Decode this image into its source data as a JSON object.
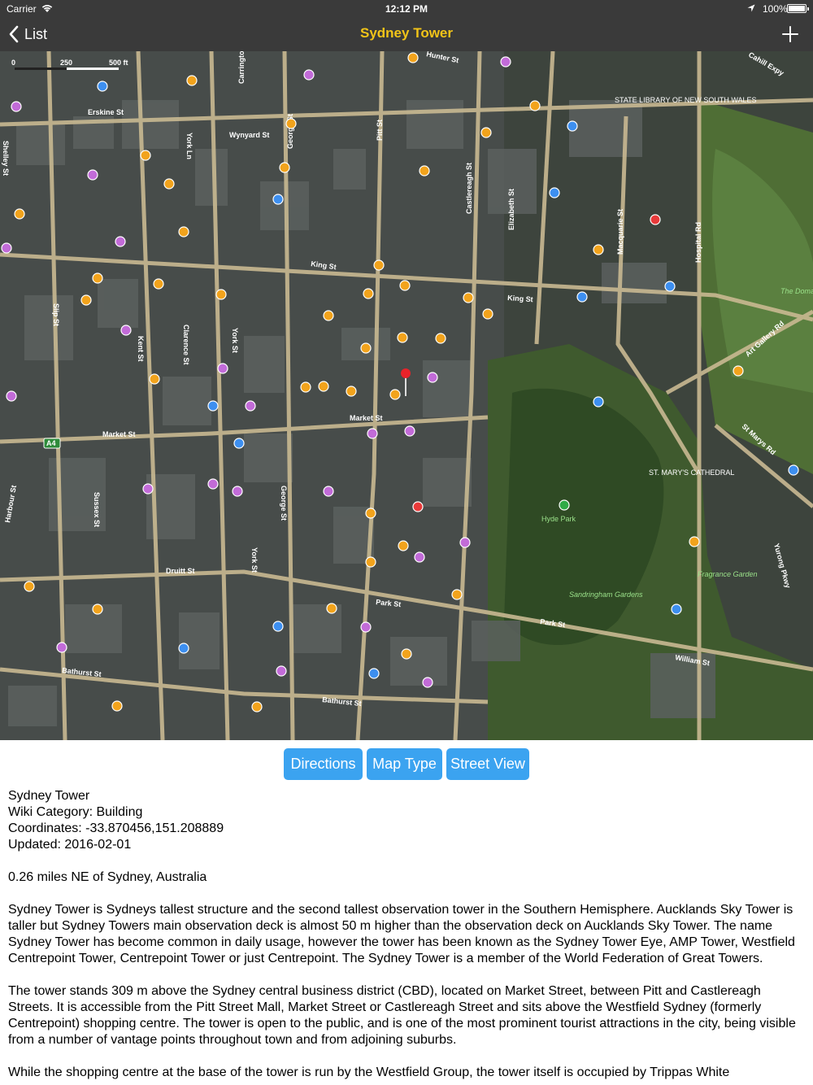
{
  "status_bar": {
    "carrier": "Carrier",
    "time": "12:12 PM",
    "battery": "100%"
  },
  "nav": {
    "back_label": "List",
    "title": "Sydney Tower",
    "title_color": "#f2c418"
  },
  "map": {
    "scale": {
      "zero": "0",
      "mid": "250",
      "end": "500 ft"
    },
    "streets": [
      "Erskine St",
      "Wynyard St",
      "Carrington St",
      "George St",
      "Pitt St",
      "Castlereagh St",
      "Elizabeth St",
      "Macquarie St",
      "Hospital Rd",
      "King St",
      "King St",
      "Market St",
      "Market St",
      "Slip St",
      "Kent St",
      "Clarence St",
      "York St",
      "Sussex St",
      "Harbour St",
      "Druitt St",
      "Park St",
      "Park St",
      "Bathurst St",
      "Bathurst St",
      "William St",
      "Art Gallery Rd",
      "St Marys Rd",
      "Yurong Pkwy",
      "York St",
      "George St",
      "Shelley St",
      "York Ln",
      "Hunter St",
      "Cahill Expy"
    ],
    "places": [
      "STATE LIBRARY OF NEW SOUTH WALES",
      "ST. MARY'S CATHEDRAL",
      "Hyde Park",
      "Sandringham Gardens",
      "Fragrance Garden",
      "The Domain"
    ],
    "route_shield": "A4"
  },
  "actions": {
    "directions": "Directions",
    "map_type": "Map Type",
    "street_view": "Street View",
    "button_color": "#3ba3f0"
  },
  "details": {
    "name": "Sydney Tower",
    "category": "Wiki Category: Building",
    "coordinates": "Coordinates: -33.870456,151.208889",
    "updated": "Updated: 2016-02-01",
    "distance": "0.26 miles NE of Sydney, Australia",
    "paragraph1": "Sydney Tower is Sydneys tallest structure and the second tallest observation tower in the Southern Hemisphere. Aucklands Sky Tower is taller but Sydney Towers main observation deck is almost 50 m higher than the observation deck on Aucklands Sky Tower. The name Sydney Tower has become common in daily usage, however the tower has been known as the Sydney Tower Eye, AMP Tower, Westfield Centrepoint Tower, Centrepoint Tower or just Centrepoint. The Sydney Tower is a member of the World Federation of Great Towers.",
    "paragraph2": "The tower stands 309 m above the Sydney central business district (CBD), located on Market Street, between Pitt and Castlereagh Streets. It is accessible from the Pitt Street Mall, Market Street or Castlereagh Street and sits above the Westfield Sydney (formerly Centrepoint) shopping centre. The tower is open to the public, and is one of the most prominent tourist attractions in the city, being visible from a number of vantage points throughout town and from adjoining suburbs.",
    "paragraph3": "While the shopping centre at the base of the tower is run by the Westfield Group, the tower itself is occupied by Trippas White"
  }
}
